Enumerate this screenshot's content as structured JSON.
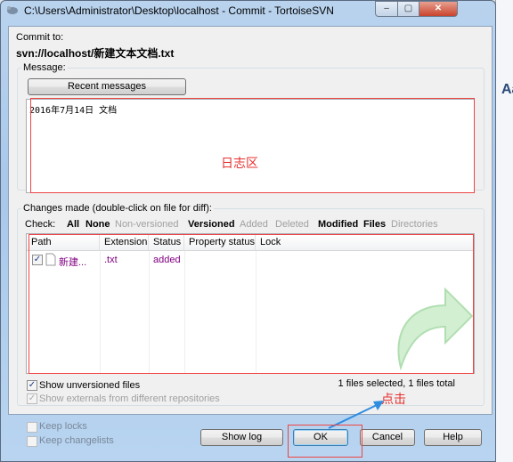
{
  "window": {
    "title": "C:\\Users\\Administrator\\Desktop\\localhost - Commit - TortoiseSVN",
    "minimize": "‒",
    "maximize": "▢",
    "close": "✕"
  },
  "commit": {
    "label": "Commit to:",
    "url": "svn://localhost/新建文本文档.txt"
  },
  "message": {
    "group_label": "Message:",
    "recent_button": "Recent messages",
    "text": "2016年7月14日 文档",
    "annotation": "日志区"
  },
  "changes": {
    "group_label": "Changes made (double-click on file for diff):",
    "check_label": "Check:",
    "filters": [
      {
        "label": "All",
        "enabled": true
      },
      {
        "label": "None",
        "enabled": true
      },
      {
        "label": "Non-versioned",
        "enabled": false
      },
      {
        "label": "Versioned",
        "enabled": true
      },
      {
        "label": "Added",
        "enabled": false
      },
      {
        "label": "Deleted",
        "enabled": false
      },
      {
        "label": "Modified",
        "enabled": true
      },
      {
        "label": "Files",
        "enabled": true
      },
      {
        "label": "Directories",
        "enabled": false
      }
    ],
    "columns": [
      "Path",
      "Extension",
      "Status",
      "Property status",
      "Lock"
    ],
    "rows": [
      {
        "checked": true,
        "path": "新建...",
        "extension": ".txt",
        "status": "added",
        "property_status": "",
        "lock": ""
      }
    ],
    "show_unversioned": {
      "label": "Show unversioned files",
      "checked": true
    },
    "show_externals": {
      "label": "Show externals from different repositories",
      "checked": true,
      "enabled": false
    },
    "summary": "1 files selected, 1 files total"
  },
  "options": {
    "keep_locks": {
      "label": "Keep locks",
      "checked": false
    },
    "keep_changelists": {
      "label": "Keep changelists",
      "checked": false
    }
  },
  "buttons": {
    "show_log": "Show log",
    "ok": "OK",
    "cancel": "Cancel",
    "help": "Help"
  },
  "annotation_click": "点击",
  "background_app": {
    "text": "Aa"
  },
  "colors": {
    "annotation": "#e83030",
    "arrow": "#2f8de0",
    "status_added": "#800080"
  }
}
